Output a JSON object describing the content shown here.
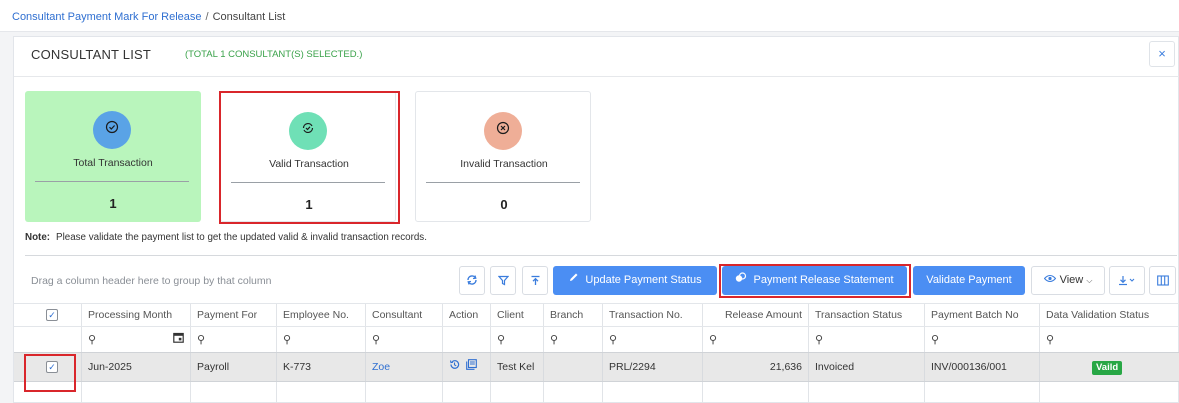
{
  "breadcrumb": {
    "parent": "Consultant Payment Mark For Release",
    "separator": "/",
    "current": "Consultant List"
  },
  "header": {
    "title": "CONSULTANT LIST",
    "subtitle": "(TOTAL 1 CONSULTANT(S) SELECTED.)",
    "close_symbol": "×"
  },
  "stats": [
    {
      "label": "Total Transaction",
      "value": "1",
      "icon": "check-circle-icon",
      "color": "#5aa3e6"
    },
    {
      "label": "Valid Transaction",
      "value": "1",
      "icon": "refresh-check-icon",
      "color": "#6fe0b6"
    },
    {
      "label": "Invalid Transaction",
      "value": "0",
      "icon": "x-circle-icon",
      "color": "#efae97"
    }
  ],
  "note": {
    "label": "Note:",
    "text": "Please validate the payment list to get the updated valid & invalid transaction records."
  },
  "grid": {
    "group_hint": "Drag a column header here to group by that column",
    "toolbar": {
      "update_payment_status": "Update Payment Status",
      "payment_release_statement": "Payment Release Statement",
      "validate_payment": "Validate Payment",
      "view": "View"
    },
    "columns": [
      "Processing Month",
      "Payment For",
      "Employee No.",
      "Consultant",
      "Action",
      "Client",
      "Branch",
      "Transaction No.",
      "Release Amount",
      "Transaction Status",
      "Payment Batch No",
      "Data Validation Status"
    ],
    "rows": [
      {
        "processing_month": "Jun-2025",
        "payment_for": "Payroll",
        "employee_no": "K-773",
        "consultant": "Zoe",
        "client": "Test Kel",
        "branch": "",
        "transaction_no": "PRL/2294",
        "release_amount": "21,636",
        "transaction_status": "Invoiced",
        "payment_batch_no": "INV/000136/001",
        "data_validation_status": "Vaild"
      }
    ]
  },
  "colors": {
    "accent": "#4b8ef3",
    "link": "#2f6fd1",
    "success": "#28a745",
    "highlight": "#d9262b",
    "total_bg": "#b9f5bc"
  }
}
